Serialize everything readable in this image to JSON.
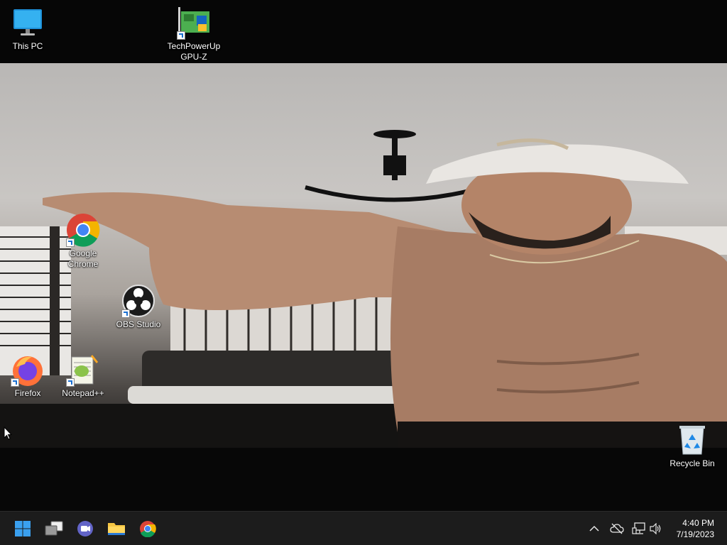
{
  "desktop": {
    "icons": [
      {
        "label": "This PC",
        "icon": "monitor-icon"
      },
      {
        "label": "TechPowerUp\nGPU-Z",
        "icon": "gpuz-icon"
      },
      {
        "label": "Google\nChrome",
        "icon": "chrome-icon"
      },
      {
        "label": "OBS Studio",
        "icon": "obs-icon"
      },
      {
        "label": "Firefox",
        "icon": "firefox-icon"
      },
      {
        "label": "Notepad++",
        "icon": "notepadpp-icon"
      },
      {
        "label": "Recycle Bin",
        "icon": "recycle-bin-icon"
      }
    ],
    "wallpaper": "photo of a shirtless man in a white cap, pointing"
  },
  "taskbar": {
    "apps": [
      {
        "name": "Start",
        "icon": "windows-start-icon"
      },
      {
        "name": "Task View",
        "icon": "task-view-icon"
      },
      {
        "name": "Chat",
        "icon": "teams-chat-icon"
      },
      {
        "name": "File Explorer",
        "icon": "folder-icon"
      },
      {
        "name": "Google Chrome",
        "icon": "chrome-icon"
      }
    ],
    "tray": {
      "icons": [
        "chevron-up-icon",
        "cloud-offline-icon",
        "network-icon",
        "volume-icon"
      ]
    },
    "clock": {
      "time": "4:40 PM",
      "date": "7/19/2023"
    }
  },
  "colors": {
    "taskbar": "#1c1c1c",
    "accent": "#0078d4"
  }
}
